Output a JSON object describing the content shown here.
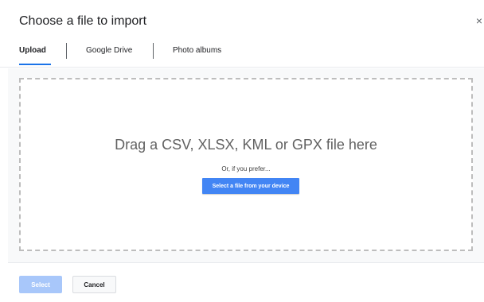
{
  "dialog": {
    "title": "Choose a file to import",
    "close_glyph": "×"
  },
  "tabs": [
    {
      "label": "Upload",
      "active": true
    },
    {
      "label": "Google Drive",
      "active": false
    },
    {
      "label": "Photo albums",
      "active": false
    }
  ],
  "dropzone": {
    "title": "Drag a CSV, XLSX, KML or GPX file here",
    "subtitle": "Or, if you prefer...",
    "button_label": "Select a file from your device"
  },
  "footer": {
    "select_label": "Select",
    "cancel_label": "Cancel"
  },
  "colors": {
    "accent": "#1a73e8",
    "primary_button": "#4285f4",
    "disabled_button": "#a8c7fa"
  }
}
